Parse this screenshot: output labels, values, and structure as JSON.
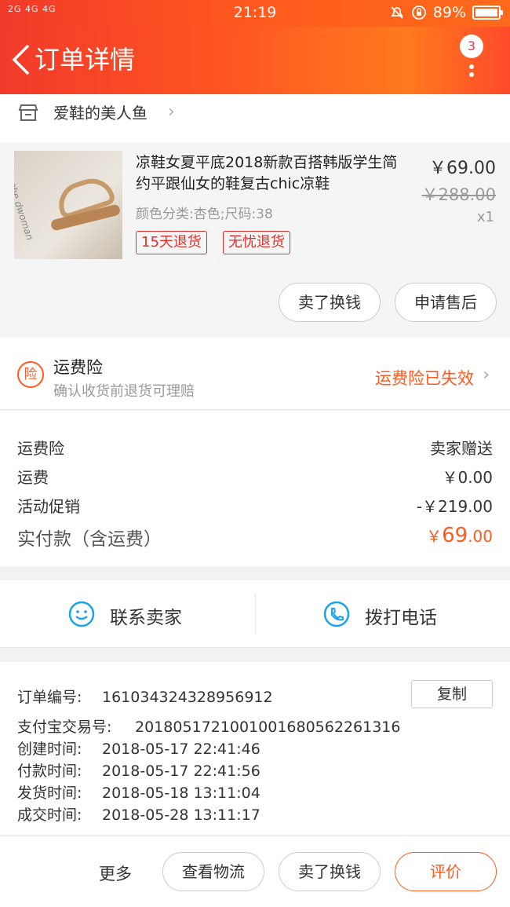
{
  "status_bar": {
    "signal_text": "2G 4G 4G",
    "time": "21:19",
    "battery_text": "89%",
    "battery_level": 0.89
  },
  "nav": {
    "title": "订单详情",
    "badge_count": "3"
  },
  "shop": {
    "name": "爱鞋的美人鱼"
  },
  "item": {
    "title": "凉鞋女夏平底2018新款百搭韩版学生简约平跟仙女的鞋复古chic凉鞋",
    "sku": "颜色分类:杏色;尺码:38",
    "tags": [
      "15天退货",
      "无忧退货"
    ],
    "price": "￥69.00",
    "original_price": "￥288.00",
    "quantity": "x1",
    "image_text": "the dwoman",
    "buttons": {
      "resell": "卖了换钱",
      "after_sale": "申请售后"
    }
  },
  "insurance": {
    "icon_char": "险",
    "title": "运费险",
    "subtitle": "确认收货前退货可理赔",
    "status": "运费险已失效"
  },
  "fees": {
    "rows": [
      {
        "label": "运费险",
        "value": "卖家赠送"
      },
      {
        "label": "运费",
        "value": "￥0.00"
      },
      {
        "label": "活动促销",
        "value": "-￥219.00"
      }
    ],
    "total_label": "实付款（含运费）",
    "total_currency": "￥",
    "total_int": "69",
    "total_dec": ".00"
  },
  "contact": {
    "seller": "联系卖家",
    "phone": "拨打电话"
  },
  "order": {
    "number_label": "订单编号:",
    "number": "161034324328956912",
    "copy": "复制",
    "alipay_label": "支付宝交易号:",
    "alipay": "2018051721001001680562261316",
    "created_label": "创建时间:",
    "created": "2018-05-17 22:41:46",
    "paid_label": "付款时间:",
    "paid": "2018-05-17 22:41:56",
    "shipped_label": "发货时间:",
    "shipped": "2018-05-18 13:11:04",
    "closed_label": "成交时间:",
    "closed": "2018-05-28 13:11:17"
  },
  "bottom": {
    "more": "更多",
    "logistics": "查看物流",
    "resell": "卖了换钱",
    "review": "评价"
  },
  "colors": {
    "accent": "#ff5a1f",
    "tag_red": "#e0302a",
    "header_red": "#f23a2a"
  }
}
